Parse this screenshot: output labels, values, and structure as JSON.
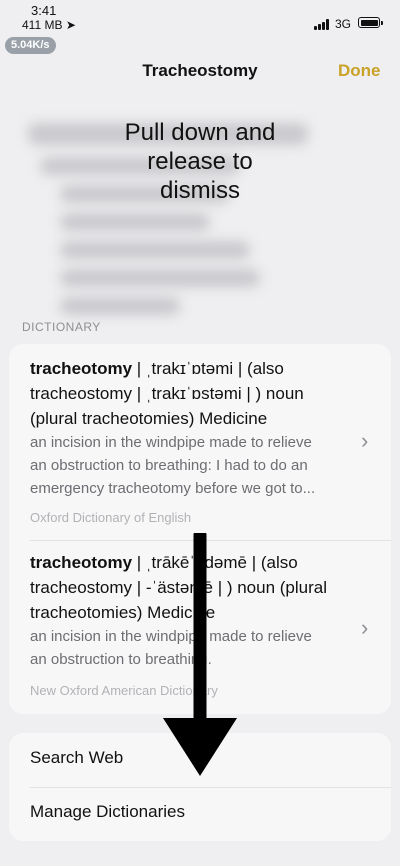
{
  "status_bar": {
    "time": "3:41",
    "memory": "411 MB",
    "speed_badge": "5.04K/s",
    "network": "3G"
  },
  "nav": {
    "title": "Tracheostomy",
    "done_label": "Done"
  },
  "overlay_message": {
    "line1": "Pull down and",
    "line2": "release to",
    "line3": "dismiss"
  },
  "section_label": "DICTIONARY",
  "entries": [
    {
      "headword": "tracheotomy",
      "head_rest_line1": " | ˌtrakɪˈɒtəmi | (also",
      "head_line2": "tracheostomy | ˌtrakɪˈɒstəmi | ) noun",
      "head_line3": "(plural tracheotomies) Medicine",
      "def_line1": "an incision in the windpipe made to relieve",
      "def_line2": "an obstruction to breathing: I had to do an",
      "def_line3": "emergency tracheotomy before we got to...",
      "source": "Oxford Dictionary of English"
    },
    {
      "headword": "tracheotomy",
      "head_rest_line1": " | ˌtrākēˈädəmē | (also",
      "head_line2": "tracheostomy | -ˈästəmē | ) noun (plural",
      "head_line3": "tracheotomies) Medicine",
      "def_line1": "an incision in the windpipe made to relieve",
      "def_line2": "an obstruction to breathing.",
      "source": "New Oxford American Dictionary"
    }
  ],
  "actions": {
    "search_web": "Search Web",
    "manage_dictionaries": "Manage Dictionaries"
  },
  "colors": {
    "accent": "#c9a227",
    "background": "#efeff1",
    "card": "#f7f7f8"
  },
  "icons": [
    "location-arrow-icon",
    "signal-bars-icon",
    "battery-icon",
    "chevron-right-icon",
    "down-arrow-icon"
  ]
}
